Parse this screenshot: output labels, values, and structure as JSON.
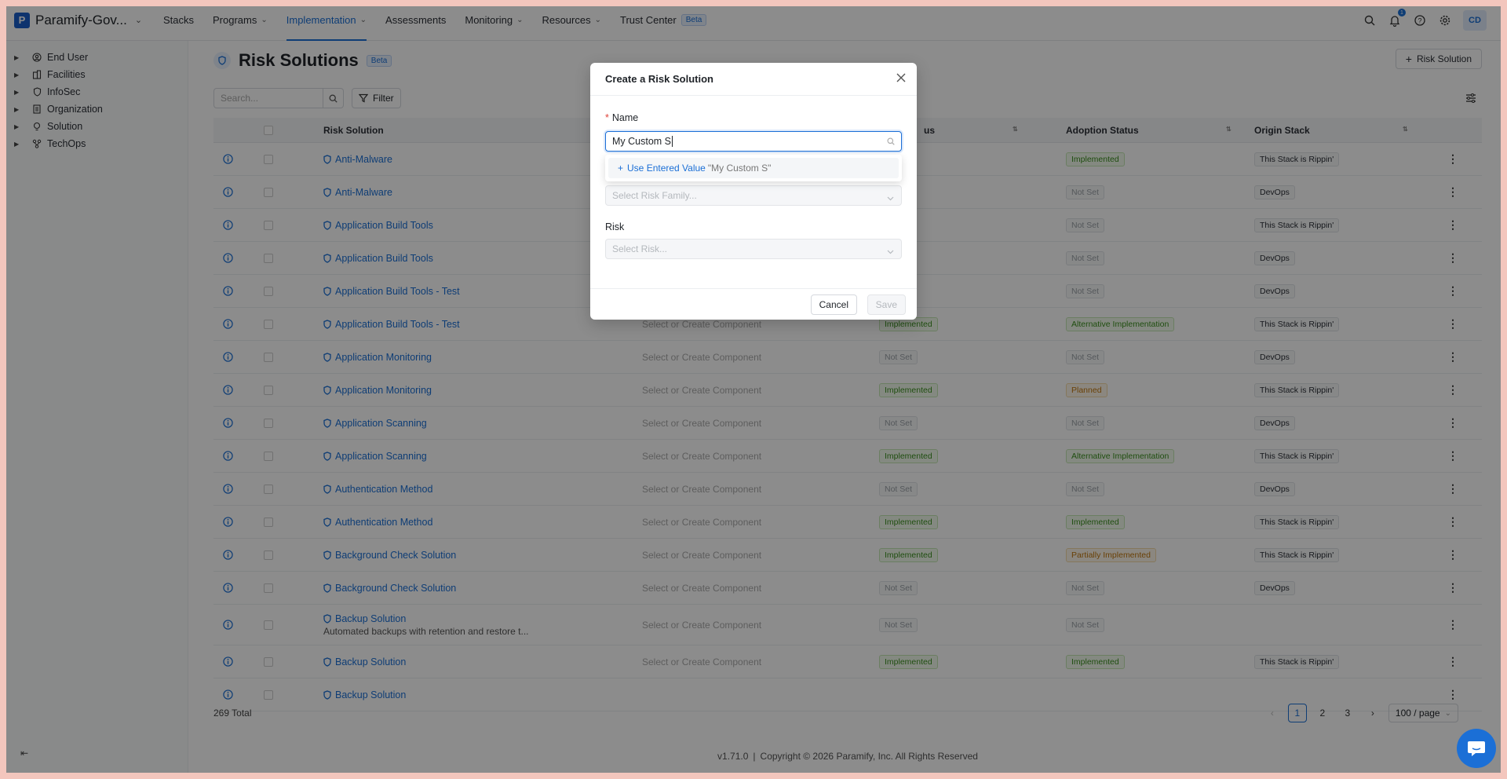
{
  "app": {
    "org_name": "Paramify-Gov...",
    "nav": [
      {
        "label": "Stacks",
        "has_menu": false
      },
      {
        "label": "Programs",
        "has_menu": true
      },
      {
        "label": "Implementation",
        "has_menu": true
      },
      {
        "label": "Assessments",
        "has_menu": false
      },
      {
        "label": "Monitoring",
        "has_menu": true
      },
      {
        "label": "Resources",
        "has_menu": true
      },
      {
        "label": "Trust Center",
        "has_menu": false
      }
    ],
    "trust_center_badge": "Beta",
    "notification_count": "1",
    "avatar_initials": "CD",
    "accent_color": "#1b6fd6"
  },
  "sidebar": {
    "items": [
      {
        "label": "End User",
        "icon": "user-circle-icon"
      },
      {
        "label": "Facilities",
        "icon": "building-icon"
      },
      {
        "label": "InfoSec",
        "icon": "shield-icon"
      },
      {
        "label": "Organization",
        "icon": "org-icon"
      },
      {
        "label": "Solution",
        "icon": "lightbulb-icon"
      },
      {
        "label": "TechOps",
        "icon": "network-icon"
      }
    ]
  },
  "page": {
    "title": "Risk Solutions",
    "title_badge": "Beta",
    "add_button_label": "Risk Solution",
    "search_placeholder": "Search...",
    "filter_label": "Filter"
  },
  "table": {
    "columns": [
      "Risk Solution",
      "us",
      "Adoption Status",
      "Origin Stack"
    ],
    "rows": [
      {
        "name": "Anti-Malware",
        "desc": "",
        "component": "",
        "impl": null,
        "adoption": {
          "text": "Implemented",
          "color": "green"
        },
        "stack": "This Stack is Rippin'"
      },
      {
        "name": "Anti-Malware",
        "desc": "",
        "component": "",
        "impl": null,
        "adoption": {
          "text": "Not Set",
          "color": "grey"
        },
        "stack": "DevOps"
      },
      {
        "name": "Application Build Tools",
        "desc": "",
        "component": "",
        "impl": {
          "text": "d",
          "color": "green"
        },
        "adoption": {
          "text": "Not Set",
          "color": "grey"
        },
        "stack": "This Stack is Rippin'"
      },
      {
        "name": "Application Build Tools",
        "desc": "",
        "component": "",
        "impl": null,
        "adoption": {
          "text": "Not Set",
          "color": "grey"
        },
        "stack": "DevOps"
      },
      {
        "name": "Application Build Tools - Test",
        "desc": "",
        "component": "",
        "impl": null,
        "adoption": {
          "text": "Not Set",
          "color": "grey"
        },
        "stack": "DevOps"
      },
      {
        "name": "Application Build Tools - Test",
        "desc": "",
        "component": "Select or Create Component",
        "impl": {
          "text": "Implemented",
          "color": "green"
        },
        "adoption": {
          "text": "Alternative Implementation",
          "color": "green"
        },
        "stack": "This Stack is Rippin'"
      },
      {
        "name": "Application Monitoring",
        "desc": "",
        "component": "Select or Create Component",
        "impl": {
          "text": "Not Set",
          "color": "grey"
        },
        "adoption": {
          "text": "Not Set",
          "color": "grey"
        },
        "stack": "DevOps"
      },
      {
        "name": "Application Monitoring",
        "desc": "",
        "component": "Select or Create Component",
        "impl": {
          "text": "Implemented",
          "color": "green"
        },
        "adoption": {
          "text": "Planned",
          "color": "orange"
        },
        "stack": "This Stack is Rippin'"
      },
      {
        "name": "Application Scanning",
        "desc": "",
        "component": "Select or Create Component",
        "impl": {
          "text": "Not Set",
          "color": "grey"
        },
        "adoption": {
          "text": "Not Set",
          "color": "grey"
        },
        "stack": "DevOps"
      },
      {
        "name": "Application Scanning",
        "desc": "",
        "component": "Select or Create Component",
        "impl": {
          "text": "Implemented",
          "color": "green"
        },
        "adoption": {
          "text": "Alternative Implementation",
          "color": "green"
        },
        "stack": "This Stack is Rippin'"
      },
      {
        "name": "Authentication Method",
        "desc": "",
        "component": "Select or Create Component",
        "impl": {
          "text": "Not Set",
          "color": "grey"
        },
        "adoption": {
          "text": "Not Set",
          "color": "grey"
        },
        "stack": "DevOps"
      },
      {
        "name": "Authentication Method",
        "desc": "",
        "component": "Select or Create Component",
        "impl": {
          "text": "Implemented",
          "color": "green"
        },
        "adoption": {
          "text": "Implemented",
          "color": "green"
        },
        "stack": "This Stack is Rippin'"
      },
      {
        "name": "Background Check Solution",
        "desc": "",
        "component": "Select or Create Component",
        "impl": {
          "text": "Implemented",
          "color": "green"
        },
        "adoption": {
          "text": "Partially Implemented",
          "color": "orange"
        },
        "stack": "This Stack is Rippin'"
      },
      {
        "name": "Background Check Solution",
        "desc": "",
        "component": "Select or Create Component",
        "impl": {
          "text": "Not Set",
          "color": "grey"
        },
        "adoption": {
          "text": "Not Set",
          "color": "grey"
        },
        "stack": "DevOps"
      },
      {
        "name": "Backup Solution",
        "desc": "Automated backups with retention and restore t...",
        "component": "Select or Create Component",
        "impl": {
          "text": "Not Set",
          "color": "grey"
        },
        "adoption": {
          "text": "Not Set",
          "color": "grey"
        },
        "stack": ""
      },
      {
        "name": "Backup Solution",
        "desc": "",
        "component": "Select or Create Component",
        "impl": {
          "text": "Implemented",
          "color": "green"
        },
        "adoption": {
          "text": "Implemented",
          "color": "green"
        },
        "stack": "This Stack is Rippin'"
      },
      {
        "name": "Backup Solution",
        "desc": "",
        "component": "",
        "impl": null,
        "adoption": null,
        "stack": ""
      }
    ]
  },
  "pagination": {
    "total": "269 Total",
    "pages": [
      "1",
      "2",
      "3"
    ],
    "current": "1",
    "per_page": "100 / page"
  },
  "footer": {
    "version": "v1.71.0",
    "copyright": "Copyright © 2026 Paramify, Inc. All Rights Reserved"
  },
  "modal": {
    "title": "Create a Risk Solution",
    "name_label": "Name",
    "name_value": "My Custom S",
    "suggestion_label": "Use Entered Value",
    "suggestion_value": "\"My Custom S\"",
    "family_placeholder": "Select Risk Family...",
    "risk_label": "Risk",
    "risk_placeholder": "Select Risk...",
    "cancel_label": "Cancel",
    "save_label": "Save"
  }
}
